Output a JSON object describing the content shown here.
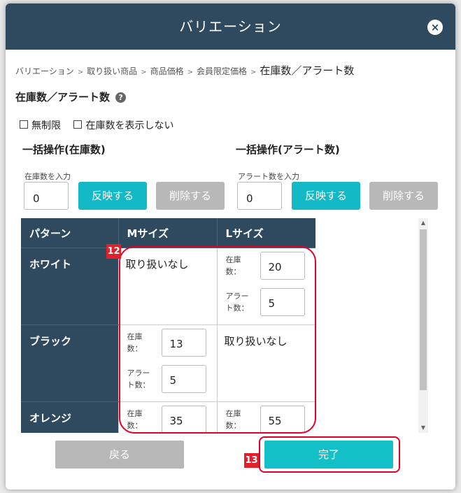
{
  "modal": {
    "title": "バリエーション",
    "close_label": "×"
  },
  "breadcrumb": {
    "items": [
      "バリエーション",
      "取り扱い商品",
      "商品価格",
      "会員限定価格"
    ],
    "separator": ">",
    "current": "在庫数／アラート数"
  },
  "section": {
    "title": "在庫数／アラート数",
    "help_label": "?"
  },
  "options": {
    "unlimited": "無制限",
    "hide_stock": "在庫数を表示しない"
  },
  "bulk_stock": {
    "title": "一括操作(在庫数)",
    "input_label": "在庫数を入力",
    "value": "0",
    "apply_label": "反映する",
    "delete_label": "削除する"
  },
  "bulk_alert": {
    "title": "一括操作(アラート数)",
    "input_label": "アラート数を入力",
    "value": "0",
    "apply_label": "反映する",
    "delete_label": "削除する"
  },
  "table": {
    "headers": [
      "パターン",
      "Mサイズ",
      "Lサイズ"
    ],
    "stock_label": "在庫数：",
    "alert_label": "アラート数：",
    "not_handled": "取り扱いなし",
    "rows": [
      {
        "pattern": "ホワイト",
        "m": {
          "stock": "",
          "alert": ""
        },
        "l": {
          "stock": "20",
          "alert": "5"
        }
      },
      {
        "pattern": "ブラック",
        "m": {
          "stock": "13",
          "alert": "5"
        },
        "l": {
          "stock": "",
          "alert": ""
        }
      },
      {
        "pattern": "オレンジ",
        "m": {
          "stock": "35",
          "alert": ""
        },
        "l": {
          "stock": "55",
          "alert": ""
        }
      }
    ]
  },
  "annotations": {
    "badge_12": "12",
    "badge_13": "13"
  },
  "footer": {
    "back_label": "戻る",
    "done_label": "完了"
  },
  "colors": {
    "header_bg": "#2f4a5e",
    "accent": "#13b9c5",
    "disabled": "#b8b8b8",
    "highlight": "#e0002a"
  }
}
